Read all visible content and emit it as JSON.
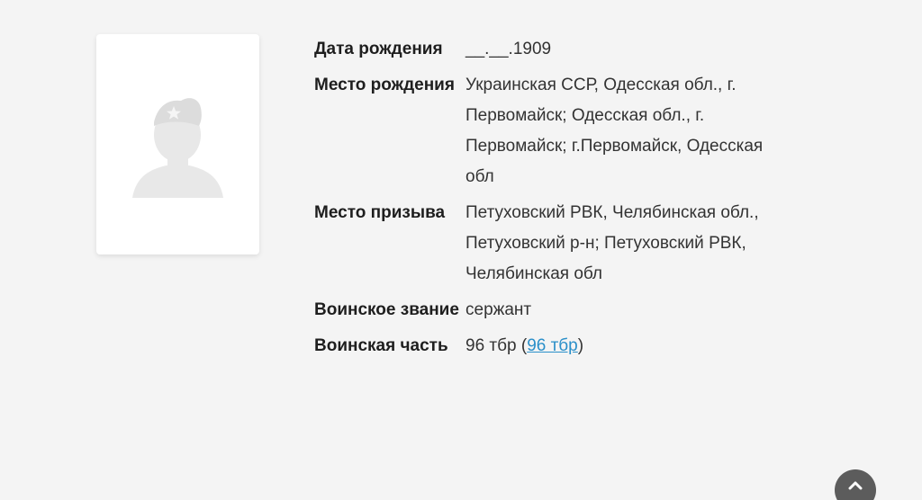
{
  "soldier": {
    "photo_icon": "soldier-silhouette-placeholder",
    "fields": [
      {
        "label": "Дата рождения",
        "value": "__.__.1909"
      },
      {
        "label": "Место рождения",
        "value": "Украинская ССР, Одесская обл., г. Первомайск; Одесская обл., г. Первомайск; г.Первомайск, Одесская обл"
      },
      {
        "label": "Место призыва",
        "value": "Петуховский РВК, Челябинская обл., Петуховский р-н; Петуховский РВК, Челябинская обл"
      },
      {
        "label": "Воинское звание",
        "value": "сержант"
      },
      {
        "label": "Воинская часть",
        "value": "96 тбр",
        "link": "96 тбр"
      }
    ]
  },
  "scroll_top": {
    "icon": "chevron-up-icon"
  },
  "colors": {
    "background": "#f4f4f4",
    "link": "#2a8fc9",
    "silhouette": "#e6e6e6",
    "scroll_button": "#5c5c5c"
  }
}
